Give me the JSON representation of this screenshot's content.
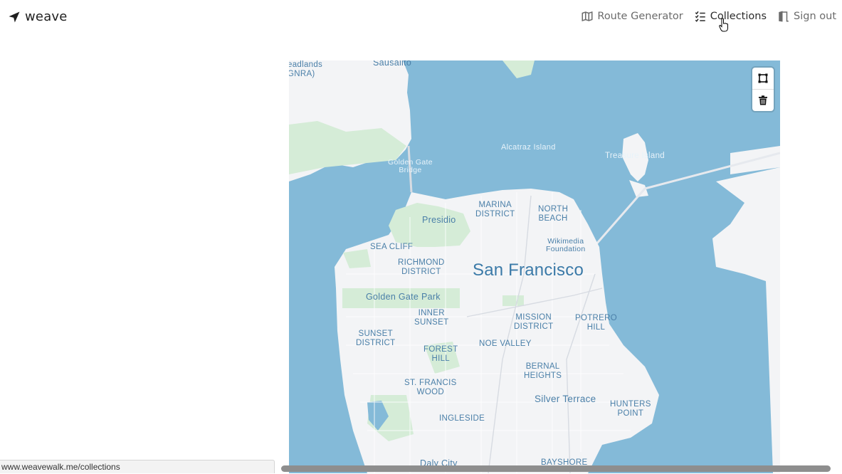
{
  "brand": {
    "name": "weave",
    "icon": "navigation-arrow-icon"
  },
  "nav": {
    "items": [
      {
        "label": "Route Generator",
        "icon": "map-icon"
      },
      {
        "label": "Collections",
        "icon": "checklist-icon"
      },
      {
        "label": "Sign out",
        "icon": "door-exit-icon"
      }
    ],
    "hovered": "Collections"
  },
  "map": {
    "controls": [
      {
        "name": "draw-polygon",
        "icon": "polygon-draw-icon"
      },
      {
        "name": "delete",
        "icon": "trash-icon"
      }
    ],
    "labels": {
      "headlands": "eadlands\nGNRA)",
      "sausalito": "Sausalito",
      "alcatraz": "Alcatraz Island",
      "treasure": "Treasure Island",
      "golden_gate_bridge": "Golden Gate\nBridge",
      "marina": "MARINA\nDISTRICT",
      "north_beach": "NORTH\nBEACH",
      "presidio": "Presidio",
      "wikimedia": "Wikimedia\nFoundation",
      "sea_cliff": "SEA CLIFF",
      "richmond": "RICHMOND\nDISTRICT",
      "city": "San Francisco",
      "golden_gate_park": "Golden Gate Park",
      "inner_sunset": "INNER\nSUNSET",
      "mission": "MISSION\nDISTRICT",
      "potrero": "POTRERO\nHILL",
      "sunset": "SUNSET\nDISTRICT",
      "forest_hill": "FOREST\nHILL",
      "noe_valley": "NOE VALLEY",
      "bernal": "BERNAL\nHEIGHTS",
      "st_francis": "ST. FRANCIS\nWOOD",
      "silver_terrace": "Silver Terrace",
      "hunters_point": "HUNTERS\nPOINT",
      "ingleside": "INGLESIDE",
      "daly_city": "Daly City",
      "bayshore": "BAYSHORE"
    },
    "colors": {
      "water": "#84bad8",
      "land": "#f3f4f6",
      "park": "#d5ecd7",
      "road": "#ffffff"
    }
  },
  "status_bar": {
    "url": "www.weavewalk.me/collections"
  }
}
